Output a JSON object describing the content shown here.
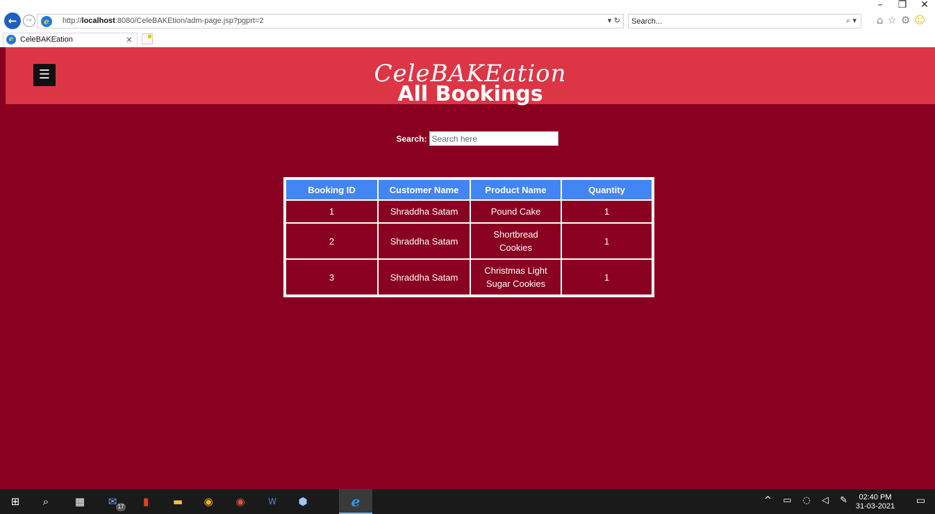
{
  "browser": {
    "url_prefix": "http://",
    "url_host": "localhost",
    "url_rest": ":8080/CeleBAKEtion/adm-page.jsp?pgprt=2",
    "address_tools": "▾ ↻",
    "search_value": "Search...",
    "search_tool": "⌕ ▾",
    "window_controls": {
      "minimize": "–",
      "restore": "❐",
      "close": "✕"
    },
    "tab_title": "CeleBAKEation",
    "tab_close": "×"
  },
  "site": {
    "menu_icon": "☰",
    "brand": "CeleBAKEation"
  },
  "main": {
    "title": "All Bookings",
    "search_label": "Search:",
    "search_placeholder": "Search here"
  },
  "table": {
    "headers": [
      "Booking ID",
      "Customer Name",
      "Product Name",
      "Quantity"
    ],
    "rows": [
      [
        "1",
        "Shraddha Satam",
        "Pound Cake",
        "1"
      ],
      [
        "2",
        "Shraddha Satam",
        "Shortbread Cookies",
        "1"
      ],
      [
        "3",
        "Shraddha Satam",
        "Christmas Light Sugar Cookies",
        "1"
      ]
    ]
  },
  "taskbar": {
    "mail_badge": "17",
    "time": "02:40 PM",
    "date": "31-03-2021",
    "icons": [
      "windows-start-icon",
      "search-icon",
      "calculator-icon",
      "mail-icon",
      "office-icon",
      "file-explorer-icon",
      "chrome-icon",
      "chrome-profile-icon",
      "word-icon",
      "box-icon",
      "internet-explorer-icon"
    ]
  },
  "colors": {
    "header_bar": "#dc3545",
    "page_background": "#8a0020",
    "table_header": "#4285f4"
  }
}
